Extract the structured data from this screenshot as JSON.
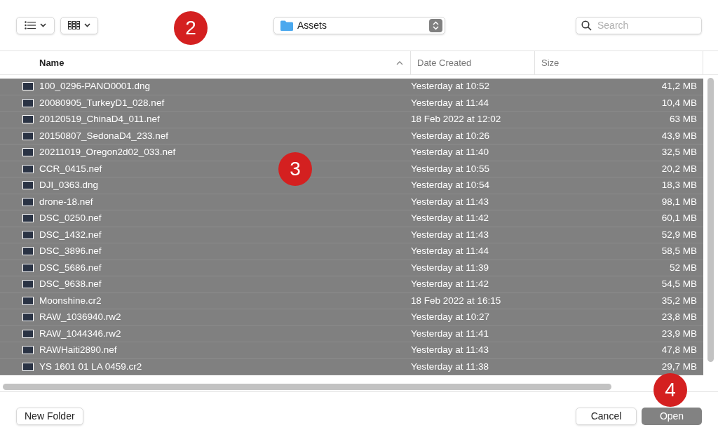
{
  "toolbar": {
    "location": "Assets",
    "search": {
      "placeholder": "Search"
    }
  },
  "table": {
    "columns": [
      {
        "label": "Name",
        "sorted": true
      },
      {
        "label": "Date Created",
        "sorted": false
      },
      {
        "label": "Size",
        "sorted": false
      }
    ],
    "rows": [
      {
        "name": "100_0296-PANO0001.dng",
        "date": "Yesterday at 10:52",
        "size": "41,2 MB",
        "selected": true
      },
      {
        "name": "20080905_TurkeyD1_028.nef",
        "date": "Yesterday at 11:44",
        "size": "10,4 MB",
        "selected": true
      },
      {
        "name": "20120519_ChinaD4_011.nef",
        "date": "18 Feb 2022 at 12:02",
        "size": "63 MB",
        "selected": true
      },
      {
        "name": "20150807_SedonaD4_233.nef",
        "date": "Yesterday at 10:26",
        "size": "43,9 MB",
        "selected": true
      },
      {
        "name": "20211019_Oregon2d02_033.nef",
        "date": "Yesterday at 11:40",
        "size": "32,5 MB",
        "selected": true
      },
      {
        "name": "CCR_0415.nef",
        "date": "Yesterday at 10:55",
        "size": "20,2 MB",
        "selected": true
      },
      {
        "name": "DJI_0363.dng",
        "date": "Yesterday at 10:54",
        "size": "18,3 MB",
        "selected": true
      },
      {
        "name": "drone-18.nef",
        "date": "Yesterday at 11:43",
        "size": "98,1 MB",
        "selected": true
      },
      {
        "name": "DSC_0250.nef",
        "date": "Yesterday at 11:42",
        "size": "60,1 MB",
        "selected": true
      },
      {
        "name": "DSC_1432.nef",
        "date": "Yesterday at 11:43",
        "size": "52,9 MB",
        "selected": true
      },
      {
        "name": "DSC_3896.nef",
        "date": "Yesterday at 11:44",
        "size": "58,5 MB",
        "selected": true
      },
      {
        "name": "DSC_5686.nef",
        "date": "Yesterday at 11:39",
        "size": "52 MB",
        "selected": true
      },
      {
        "name": "DSC_9638.nef",
        "date": "Yesterday at 11:42",
        "size": "54,5 MB",
        "selected": true
      },
      {
        "name": "Moonshine.cr2",
        "date": "18 Feb 2022 at 16:15",
        "size": "35,2 MB",
        "selected": true
      },
      {
        "name": "RAW_1036940.rw2",
        "date": "Yesterday at 10:27",
        "size": "23,8 MB",
        "selected": true
      },
      {
        "name": "RAW_1044346.rw2",
        "date": "Yesterday at 11:41",
        "size": "23,9 MB",
        "selected": true
      },
      {
        "name": "RAWHaiti2890.nef",
        "date": "Yesterday at 11:43",
        "size": "47,8 MB",
        "selected": true
      },
      {
        "name": "YS 1601 01 LA 0459.cr2",
        "date": "Yesterday at 11:38",
        "size": "29,7 MB",
        "selected": true
      }
    ]
  },
  "buttons": {
    "new_folder": "New Folder",
    "cancel": "Cancel",
    "open": "Open"
  },
  "callouts": [
    "2",
    "3",
    "4"
  ]
}
